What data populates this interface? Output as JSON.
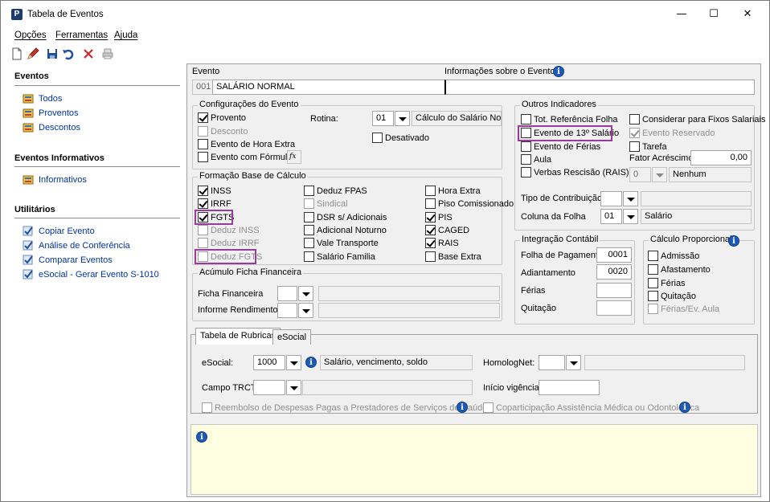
{
  "window": {
    "title": "Tabela de Eventos",
    "minimize": "—",
    "maximize": "☐",
    "close": "✕"
  },
  "menu": [
    "Opções",
    "Ferramentas",
    "Ajuda"
  ],
  "toolbar_icons": [
    "new-icon",
    "edit-icon",
    "save-icon",
    "undo-icon",
    "delete-icon",
    "print-icon"
  ],
  "sidebar": {
    "eventos_title": "Eventos",
    "eventos": [
      "Todos",
      "Proventos",
      "Descontos"
    ],
    "informativos_title": "Eventos Informativos",
    "informativos": [
      "Informativos"
    ],
    "utilitarios_title": "Utilitários",
    "utilitarios": [
      "Copiar Evento",
      "Análise de Conferência",
      "Comparar Eventos",
      "eSocial - Gerar Evento S-1010"
    ]
  },
  "evento": {
    "label": "Evento",
    "code": "001",
    "name": "SALÁRIO NORMAL",
    "info_label": "Informações sobre o Evento",
    "info_value": ""
  },
  "config": {
    "title": "Configurações do Evento",
    "provento": "Provento",
    "desconto": "Desconto",
    "hora_extra": "Evento de Hora Extra",
    "com_formula": "Evento com Fórmula",
    "fx": "fx",
    "rotina_label": "Rotina:",
    "rotina_code": "01",
    "rotina_desc": "Cálculo do Salário Norma",
    "desativado": "Desativado"
  },
  "base": {
    "title": "Formação Base de Cálculo",
    "col1": [
      "INSS",
      "IRRF",
      "FGTS",
      "Deduz INSS",
      "Deduz IRRF",
      "Deduz FGTS"
    ],
    "col2": [
      "Deduz FPAS",
      "Sindical",
      "DSR s/ Adicionais",
      "Adicional Noturno",
      "Vale Transporte",
      "Salário Familia"
    ],
    "col3": [
      "Hora Extra",
      "Piso Comissionado",
      "PIS",
      "CAGED",
      "RAIS",
      "Base Extra"
    ]
  },
  "acumulo": {
    "title": "Acúmulo Ficha Financeira",
    "ficha": "Ficha Financeira",
    "informe": "Informe Rendimentos"
  },
  "outros": {
    "title": "Outros Indicadores",
    "tot_ref": "Tot. Referência Folha",
    "decimo": "Evento de 13º Salário",
    "ferias": "Evento de Férias",
    "aula": "Aula",
    "verbas": "Verbas Rescisão (RAIS)",
    "fixos": "Considerar para Fixos Salariais",
    "reservado": "Evento Reservado",
    "tarefa": "Tarefa",
    "fator_label": "Fator Acréscimo",
    "fator_value": "0,00",
    "verbas_code": "0",
    "verbas_desc": "Nenhum",
    "tipo_contrib": "Tipo de Contribuição",
    "coluna_folha": "Coluna da Folha",
    "coluna_code": "01",
    "coluna_desc": "Salário"
  },
  "integracao": {
    "title": "Integração Contábil",
    "folha_label": "Folha de Pagamento",
    "folha_value": "0001",
    "adiant_label": "Adiantamento",
    "adiant_value": "0020",
    "ferias_label": "Férias",
    "quitacao_label": "Quitação"
  },
  "proporcional": {
    "title": "Cálculo Proporcional",
    "items": [
      "Admissão",
      "Afastamento",
      "Férias",
      "Quitação",
      "Férias/Ev. Aula"
    ]
  },
  "tabs": [
    "Tabela de Rubricas",
    "eSocial"
  ],
  "esocial": {
    "label": "eSocial:",
    "code": "1000",
    "desc": "Salário, vencimento, soldo",
    "homolog": "HomologNet:",
    "trct": "Campo TRCT:",
    "inicio": "Início vigência:",
    "reembolso": "Reembolso de Despesas Pagas a Prestadores de Serviços de Saúde",
    "coparticipacao": "Coparticipação Assistência Médica ou Odontológica"
  },
  "colors": {
    "accent": "#1f5bb5",
    "highlight": "#9b3a9e",
    "link": "#0033aa",
    "notes_bg": "#ffffe1"
  }
}
